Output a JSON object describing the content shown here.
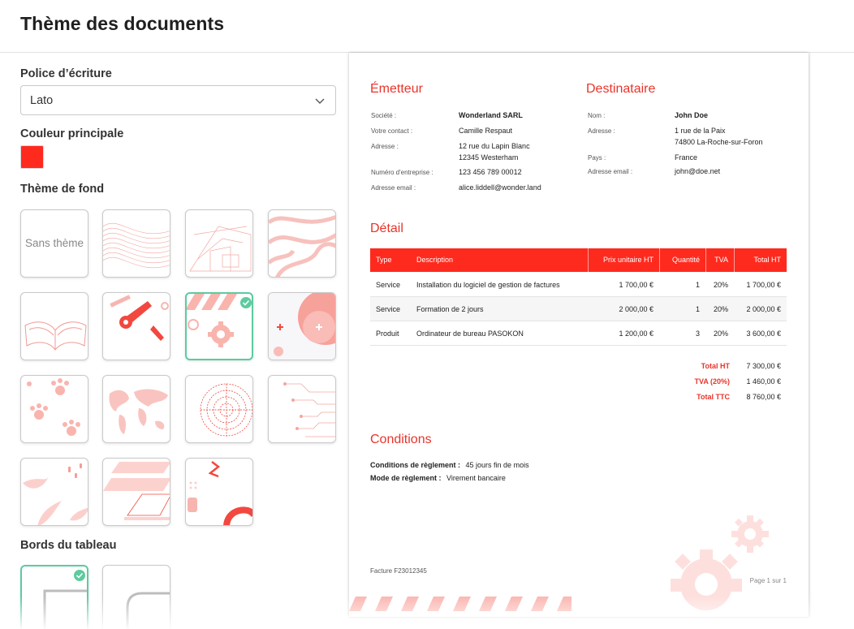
{
  "page": {
    "title": "Thème des documents"
  },
  "settings": {
    "font_label": "Police d’écriture",
    "font_value": "Lato",
    "color_label": "Couleur principale",
    "color_value": "#ff2a1e",
    "background_label": "Thème de fond",
    "no_theme_label": "Sans thème",
    "selected_theme_index": 6,
    "borders_label": "Bords du tableau",
    "selected_border_index": 0
  },
  "invoice": {
    "issuer": {
      "heading": "Émetteur",
      "rows": [
        {
          "label": "Société :",
          "value": "Wonderland SARL"
        },
        {
          "label": "Votre contact :",
          "value": "Camille Respaut"
        },
        {
          "label": "Adresse :",
          "value": "12 rue du Lapin Blanc",
          "value2": "12345 Westerham"
        },
        {
          "label": "Numéro d'entreprise :",
          "value": "123 456 789 00012"
        },
        {
          "label": "Adresse email :",
          "value": "alice.liddell@wonder.land"
        }
      ]
    },
    "recipient": {
      "heading": "Destinataire",
      "rows": [
        {
          "label": "Nom :",
          "value": "John Doe"
        },
        {
          "label": "Adresse :",
          "value": "1 rue de la Paix",
          "value2": "74800 La-Roche-sur-Foron"
        },
        {
          "label": "Pays :",
          "value": "France"
        },
        {
          "label": "Adresse email :",
          "value": "john@doe.net"
        }
      ]
    },
    "detail_heading": "Détail",
    "columns": [
      "Type",
      "Description",
      "Prix unitaire HT",
      "Quantité",
      "TVA",
      "Total HT"
    ],
    "rows": [
      [
        "Service",
        "Installation du logiciel de gestion de factures",
        "1 700,00 €",
        "1",
        "20%",
        "1 700,00 €"
      ],
      [
        "Service",
        "Formation de 2 jours",
        "2 000,00 €",
        "1",
        "20%",
        "2 000,00 €"
      ],
      [
        "Produit",
        "Ordinateur de bureau PASOKON",
        "1 200,00 €",
        "3",
        "20%",
        "3 600,00 €"
      ]
    ],
    "totals": [
      {
        "label": "Total HT",
        "value": "7 300,00 €"
      },
      {
        "label": "TVA (20%)",
        "value": "1 460,00 €"
      },
      {
        "label": "Total TTC",
        "value": "8 760,00 €"
      }
    ],
    "conditions": {
      "heading": "Conditions",
      "payment_terms_label": "Conditions de règlement :",
      "payment_terms_value": "45 jours fin de mois",
      "payment_mode_label": "Mode de règlement :",
      "payment_mode_value": "Virement bancaire"
    },
    "footer_invoice": "Facture F23012345",
    "footer_page": "Page 1 sur 1"
  },
  "icons": [
    "chevron-down-icon",
    "check-icon",
    "gear-icon"
  ]
}
